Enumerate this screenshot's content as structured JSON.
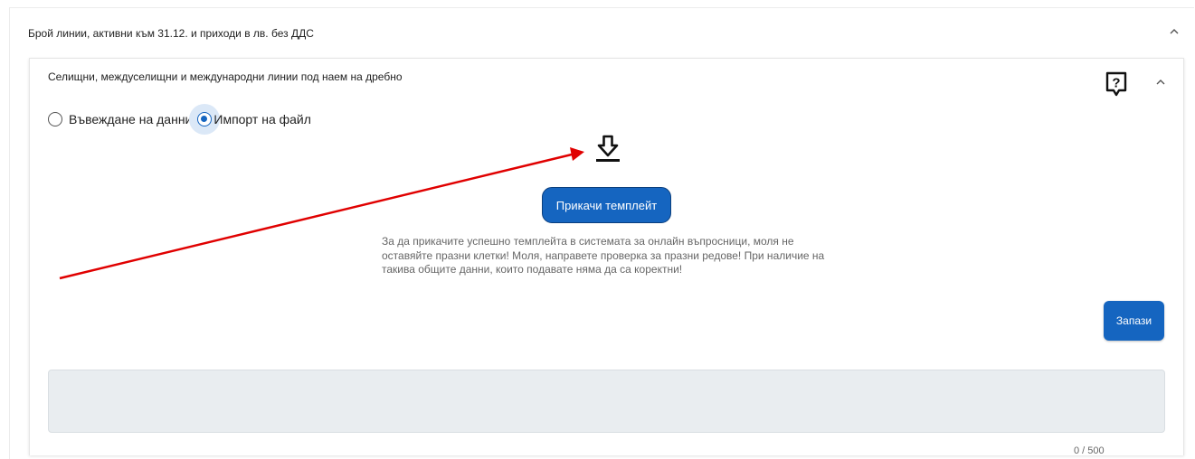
{
  "outer_section": {
    "title": "Брой линии, активни към 31.12. и приходи в лв. без ДДС",
    "chevron_icon": "chevron-up-icon"
  },
  "inner_section": {
    "title": "Селищни, междуселищни и международни линии под наем на дребно",
    "help_icon": "help-question-icon",
    "chevron_icon": "chevron-up-icon",
    "input_mode": {
      "options": [
        "Въвеждане на данни",
        "Импорт на файл"
      ],
      "selected": "Импорт на файл"
    },
    "download_icon": "download-icon",
    "upload_button_label": "Прикачи темплейт",
    "notice": "За да прикачите успешно темплейта в системата за онлайн въпросници, моля не оставяйте празни клетки! Моля, направете проверка за празни редове! При наличие на такива общите данни, които подавате няма да са коректни!",
    "save_button_label": "Запази",
    "comment": {
      "value": "",
      "counter": "0 / 500"
    }
  },
  "annotation": {
    "type": "arrow",
    "color": "#e00000"
  },
  "colors": {
    "primary": "#1565c0",
    "annotation": "#e00000",
    "field_bg": "#e9edf0"
  }
}
